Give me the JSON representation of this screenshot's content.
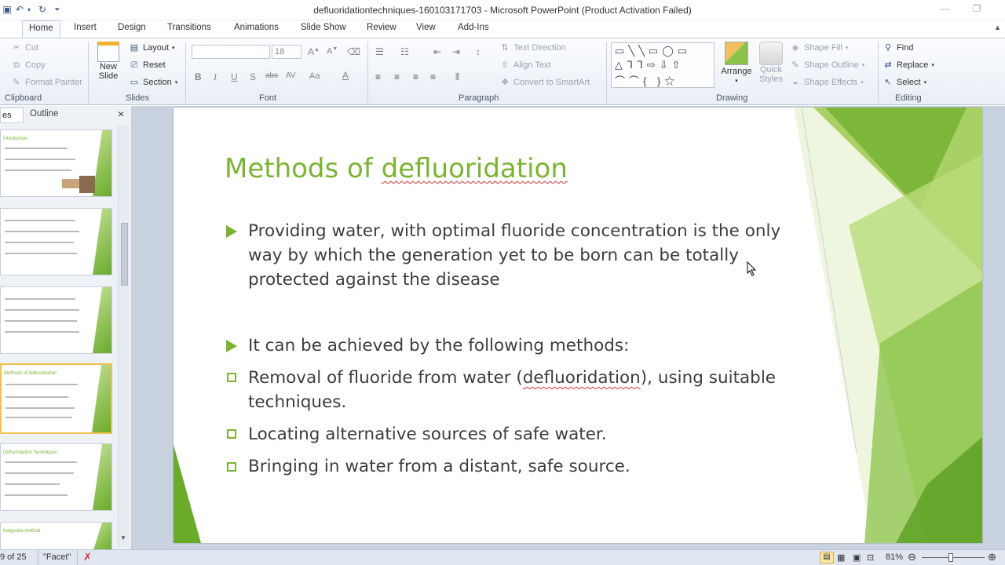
{
  "window": {
    "title": "defluoridationtechniques-160103171703  -  Microsoft PowerPoint (Product Activation Failed)"
  },
  "tabs": [
    "Home",
    "Insert",
    "Design",
    "Transitions",
    "Animations",
    "Slide Show",
    "Review",
    "View",
    "Add-Ins"
  ],
  "active_tab": "Home",
  "ribbon": {
    "clipboard": {
      "label": "Clipboard",
      "cut": "Cut",
      "copy": "Copy",
      "format_painter": "Format Painter"
    },
    "slides": {
      "label": "Slides",
      "new_slide_line1": "New",
      "new_slide_line2": "Slide",
      "layout": "Layout",
      "reset": "Reset",
      "section": "Section"
    },
    "font": {
      "label": "Font",
      "size": "18"
    },
    "paragraph": {
      "label": "Paragraph",
      "text_direction": "Text Direction",
      "align_text": "Align Text",
      "convert_smartart": "Convert to SmartArt"
    },
    "drawing": {
      "label": "Drawing",
      "arrange": "Arrange",
      "quick_styles_line1": "Quick",
      "quick_styles_line2": "Styles",
      "shape_fill": "Shape Fill",
      "shape_outline": "Shape Outline",
      "shape_effects": "Shape Effects"
    },
    "editing": {
      "label": "Editing",
      "find": "Find",
      "replace": "Replace",
      "select": "Select"
    }
  },
  "panel": {
    "tab_slides": "es",
    "tab_outline": "Outline",
    "close": "×"
  },
  "thumbnails": [
    {
      "title": "Introduction"
    },
    {
      "title": ""
    },
    {
      "title": ""
    },
    {
      "title": "Methods of defluoridation"
    },
    {
      "title": "Defluoridation Techniques"
    },
    {
      "title": "Nalgonda method"
    }
  ],
  "slide": {
    "title_plain": "Methods of ",
    "title_underlined": "defluoridation",
    "bullet1": " Providing water, with optimal fluoride concentration is the only way by which the generation yet to be born can be totally protected against the disease",
    "bullet2": " It can be achieved by the following methods:",
    "sub1_pre": "Removal of fluoride from water (",
    "sub1_underlined": "defluoridation",
    "sub1_post": "), using suitable techniques.",
    "sub2": "Locating alternative sources of safe water.",
    "sub3": "Bringing in water from a distant, safe source."
  },
  "status": {
    "slide_counter": "9 of 25",
    "theme": "\"Facet\"",
    "zoom": "81%"
  },
  "colors": {
    "accent_green": "#7ab432",
    "file_tab": "#e65a2a"
  }
}
